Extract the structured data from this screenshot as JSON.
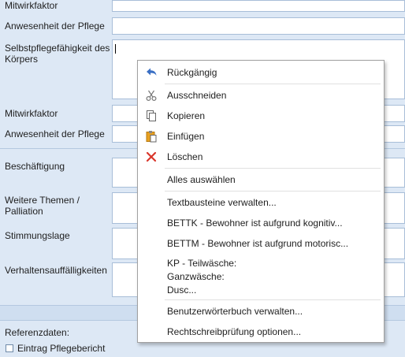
{
  "form": {
    "labels": {
      "mitwirkfaktor_1": "Mitwirkfaktor",
      "anwesenheit_1": "Anwesenheit der Pflege",
      "selbstpflege": "Selbstpflegefähigkeit des Körpers",
      "mitwirkfaktor_2": "Mitwirkfaktor",
      "anwesenheit_2": "Anwesenheit der Pflege",
      "beschaeftigung": "Beschäftigung",
      "weitere_themen": "Weitere Themen / Palliation",
      "stimmungslage": "Stimmungslage",
      "verhalten": "Verhaltensauffälligkeiten",
      "referenzdaten": "Referenzdaten:"
    },
    "checkbox_eintrag": {
      "label": "Eintrag Pflegebericht",
      "checked": false
    }
  },
  "context_menu": {
    "items": {
      "undo": "Rückgängig",
      "cut": "Ausschneiden",
      "copy": "Kopieren",
      "paste": "Einfügen",
      "delete": "Löschen",
      "select_all": "Alles auswählen",
      "manage_text_blocks": "Textbausteine verwalten...",
      "bettk": "BETTK - Bewohner ist aufgrund kognitiv...",
      "bettm": "BETTM - Bewohner ist aufgrund motorisc...",
      "kp_line1": "KP - Teilwäsche:",
      "kp_line2": "Ganzwäsche:",
      "kp_line3": "Dusc...",
      "manage_dictionary": "Benutzerwörterbuch verwalten...",
      "spellcheck_options": "Rechtschreibprüfung optionen..."
    }
  },
  "colors": {
    "background": "#dde8f5",
    "field_border": "#a8bed8",
    "undo_icon": "#3a6fc4",
    "delete_icon": "#d9362b",
    "paste_icon": "#e8a020"
  }
}
